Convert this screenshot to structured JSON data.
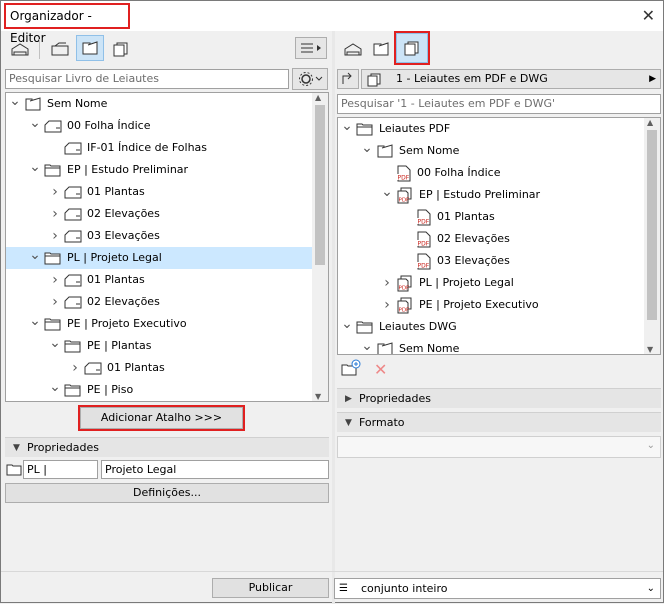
{
  "window": {
    "title": "Organizador - Editor",
    "close": "✕"
  },
  "left": {
    "search_placeholder": "Pesquisar Livro de Leiautes",
    "tree": [
      {
        "label": "Sem Nome",
        "level": 0,
        "chev": "down",
        "icon": "book"
      },
      {
        "label": "00 Folha Índice",
        "level": 1,
        "chev": "down",
        "icon": "sheet"
      },
      {
        "label": "IF-01 Índice de Folhas",
        "level": 2,
        "chev": "",
        "icon": "sheet"
      },
      {
        "label": "EP | Estudo Preliminar",
        "level": 1,
        "chev": "down",
        "icon": "folder"
      },
      {
        "label": "01 Plantas",
        "level": 2,
        "chev": "right",
        "icon": "sheet"
      },
      {
        "label": "02 Elevações",
        "level": 2,
        "chev": "right",
        "icon": "sheet"
      },
      {
        "label": "03 Elevações",
        "level": 2,
        "chev": "right",
        "icon": "sheet"
      },
      {
        "label": "PL | Projeto Legal",
        "level": 1,
        "chev": "down",
        "icon": "folder",
        "selected": true
      },
      {
        "label": "01 Plantas",
        "level": 2,
        "chev": "right",
        "icon": "sheet"
      },
      {
        "label": "02 Elevações",
        "level": 2,
        "chev": "right",
        "icon": "sheet"
      },
      {
        "label": "PE | Projeto Executivo",
        "level": 1,
        "chev": "down",
        "icon": "folder"
      },
      {
        "label": "PE | Plantas",
        "level": 2,
        "chev": "down",
        "icon": "folder"
      },
      {
        "label": "01 Plantas",
        "level": 3,
        "chev": "right",
        "icon": "sheet"
      },
      {
        "label": "PE | Piso",
        "level": 2,
        "chev": "down",
        "icon": "folder"
      }
    ],
    "add_shortcut": "Adicionar Atalho >>>",
    "properties_title": "Propriedades",
    "prop_id": "PL |",
    "prop_name": "Projeto Legal",
    "settings_button": "Definições..."
  },
  "right": {
    "set_selector": "1 - Leiautes em PDF e DWG",
    "search_placeholder": "Pesquisar '1 - Leiautes em PDF e DWG'",
    "tree": [
      {
        "label": "Leiautes PDF",
        "level": 0,
        "chev": "down",
        "icon": "folder"
      },
      {
        "label": "Sem Nome",
        "level": 1,
        "chev": "down",
        "icon": "book"
      },
      {
        "label": "00 Folha Índice",
        "level": 2,
        "chev": "",
        "icon": "pdf"
      },
      {
        "label": "EP | Estudo Preliminar",
        "level": 2,
        "chev": "down",
        "icon": "pdfset"
      },
      {
        "label": "01 Plantas",
        "level": 3,
        "chev": "",
        "icon": "pdf"
      },
      {
        "label": "02 Elevações",
        "level": 3,
        "chev": "",
        "icon": "pdf"
      },
      {
        "label": "03 Elevações",
        "level": 3,
        "chev": "",
        "icon": "pdf"
      },
      {
        "label": "PL | Projeto Legal",
        "level": 2,
        "chev": "right",
        "icon": "pdfset"
      },
      {
        "label": "PE | Projeto Executivo",
        "level": 2,
        "chev": "right",
        "icon": "pdfset"
      },
      {
        "label": "Leiautes DWG",
        "level": 0,
        "chev": "down",
        "icon": "folder"
      },
      {
        "label": "Sem Nome",
        "level": 1,
        "chev": "down",
        "icon": "book"
      }
    ],
    "properties_title": "Propriedades",
    "format_title": "Formato"
  },
  "footer": {
    "publish": "Publicar",
    "scope": "conjunto inteiro"
  },
  "colors": {
    "highlight": "#e02020",
    "selection": "#cce8ff",
    "active_tool": "#cce4f7"
  }
}
